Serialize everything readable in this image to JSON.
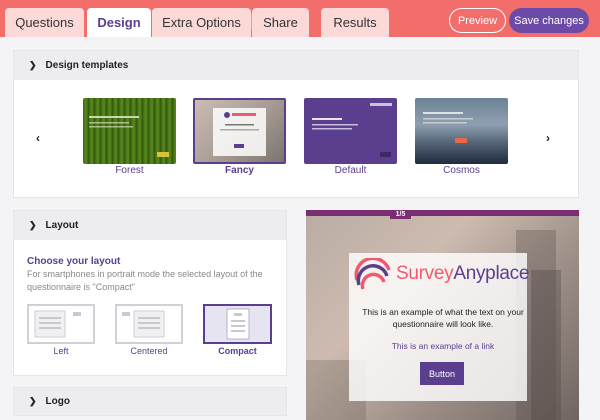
{
  "tabs": [
    {
      "label": "Questions"
    },
    {
      "label": "Design"
    },
    {
      "label": "Extra Options"
    },
    {
      "label": "Share"
    },
    {
      "label": "Results"
    }
  ],
  "actions": {
    "preview": "Preview",
    "save": "Save changes"
  },
  "design_templates": {
    "title": "Design templates",
    "items": [
      {
        "name": "Forest",
        "selected": false
      },
      {
        "name": "Fancy",
        "selected": true
      },
      {
        "name": "Default",
        "selected": false
      },
      {
        "name": "Cosmos",
        "selected": false
      }
    ],
    "thumb_brand": "SurveyAnyplace",
    "thumb_welcome": "Welcome"
  },
  "layout": {
    "title": "Layout",
    "choose_title": "Choose your layout",
    "description": "For smartphones in portrait mode the selected layout of the questionnaire is \"Compact\"",
    "options": [
      {
        "label": "Left",
        "selected": false
      },
      {
        "label": "Centered",
        "selected": false
      },
      {
        "label": "Compact",
        "selected": true
      }
    ]
  },
  "logo": {
    "title": "Logo"
  },
  "preview": {
    "progress": "1/5",
    "brand_survey": "Survey",
    "brand_anyplace": "Anyplace",
    "text": "This is an example of what the text on your questionnaire will look like.",
    "link": "This is an example of a link",
    "button": "Button"
  },
  "colors": {
    "topbar": "#f36e6b",
    "accent": "#5b3e8e",
    "save_button": "#6c4aa8",
    "brand_red": "#ef5a6f",
    "progress": "#7b2d73"
  }
}
